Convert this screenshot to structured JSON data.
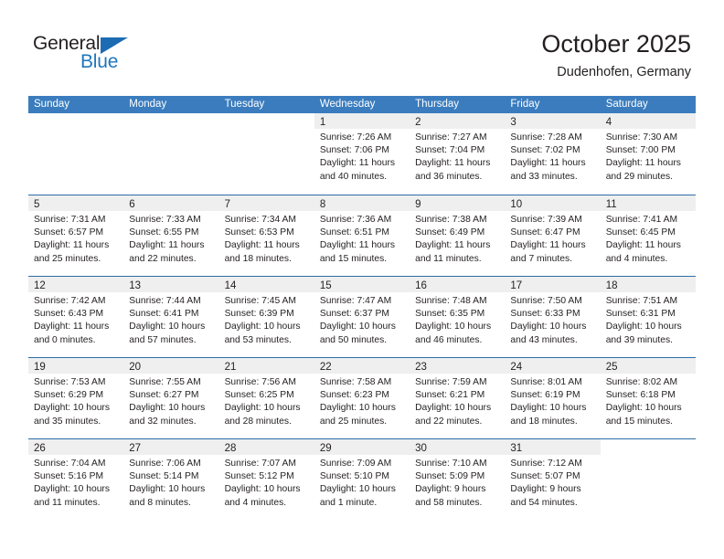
{
  "brand": {
    "name_part1": "General",
    "name_part2": "Blue",
    "accent_color": "#1d6cb3"
  },
  "header": {
    "month_title": "October 2025",
    "location": "Dudenhofen, Germany"
  },
  "calendar": {
    "header_bg": "#3a7cbe",
    "daynum_bg": "#efefef",
    "weekdays": [
      "Sunday",
      "Monday",
      "Tuesday",
      "Wednesday",
      "Thursday",
      "Friday",
      "Saturday"
    ],
    "weeks": [
      [
        {
          "day": "",
          "lines": []
        },
        {
          "day": "",
          "lines": []
        },
        {
          "day": "",
          "lines": []
        },
        {
          "day": "1",
          "lines": [
            "Sunrise: 7:26 AM",
            "Sunset: 7:06 PM",
            "Daylight: 11 hours",
            "and 40 minutes."
          ]
        },
        {
          "day": "2",
          "lines": [
            "Sunrise: 7:27 AM",
            "Sunset: 7:04 PM",
            "Daylight: 11 hours",
            "and 36 minutes."
          ]
        },
        {
          "day": "3",
          "lines": [
            "Sunrise: 7:28 AM",
            "Sunset: 7:02 PM",
            "Daylight: 11 hours",
            "and 33 minutes."
          ]
        },
        {
          "day": "4",
          "lines": [
            "Sunrise: 7:30 AM",
            "Sunset: 7:00 PM",
            "Daylight: 11 hours",
            "and 29 minutes."
          ]
        }
      ],
      [
        {
          "day": "5",
          "lines": [
            "Sunrise: 7:31 AM",
            "Sunset: 6:57 PM",
            "Daylight: 11 hours",
            "and 25 minutes."
          ]
        },
        {
          "day": "6",
          "lines": [
            "Sunrise: 7:33 AM",
            "Sunset: 6:55 PM",
            "Daylight: 11 hours",
            "and 22 minutes."
          ]
        },
        {
          "day": "7",
          "lines": [
            "Sunrise: 7:34 AM",
            "Sunset: 6:53 PM",
            "Daylight: 11 hours",
            "and 18 minutes."
          ]
        },
        {
          "day": "8",
          "lines": [
            "Sunrise: 7:36 AM",
            "Sunset: 6:51 PM",
            "Daylight: 11 hours",
            "and 15 minutes."
          ]
        },
        {
          "day": "9",
          "lines": [
            "Sunrise: 7:38 AM",
            "Sunset: 6:49 PM",
            "Daylight: 11 hours",
            "and 11 minutes."
          ]
        },
        {
          "day": "10",
          "lines": [
            "Sunrise: 7:39 AM",
            "Sunset: 6:47 PM",
            "Daylight: 11 hours",
            "and 7 minutes."
          ]
        },
        {
          "day": "11",
          "lines": [
            "Sunrise: 7:41 AM",
            "Sunset: 6:45 PM",
            "Daylight: 11 hours",
            "and 4 minutes."
          ]
        }
      ],
      [
        {
          "day": "12",
          "lines": [
            "Sunrise: 7:42 AM",
            "Sunset: 6:43 PM",
            "Daylight: 11 hours",
            "and 0 minutes."
          ]
        },
        {
          "day": "13",
          "lines": [
            "Sunrise: 7:44 AM",
            "Sunset: 6:41 PM",
            "Daylight: 10 hours",
            "and 57 minutes."
          ]
        },
        {
          "day": "14",
          "lines": [
            "Sunrise: 7:45 AM",
            "Sunset: 6:39 PM",
            "Daylight: 10 hours",
            "and 53 minutes."
          ]
        },
        {
          "day": "15",
          "lines": [
            "Sunrise: 7:47 AM",
            "Sunset: 6:37 PM",
            "Daylight: 10 hours",
            "and 50 minutes."
          ]
        },
        {
          "day": "16",
          "lines": [
            "Sunrise: 7:48 AM",
            "Sunset: 6:35 PM",
            "Daylight: 10 hours",
            "and 46 minutes."
          ]
        },
        {
          "day": "17",
          "lines": [
            "Sunrise: 7:50 AM",
            "Sunset: 6:33 PM",
            "Daylight: 10 hours",
            "and 43 minutes."
          ]
        },
        {
          "day": "18",
          "lines": [
            "Sunrise: 7:51 AM",
            "Sunset: 6:31 PM",
            "Daylight: 10 hours",
            "and 39 minutes."
          ]
        }
      ],
      [
        {
          "day": "19",
          "lines": [
            "Sunrise: 7:53 AM",
            "Sunset: 6:29 PM",
            "Daylight: 10 hours",
            "and 35 minutes."
          ]
        },
        {
          "day": "20",
          "lines": [
            "Sunrise: 7:55 AM",
            "Sunset: 6:27 PM",
            "Daylight: 10 hours",
            "and 32 minutes."
          ]
        },
        {
          "day": "21",
          "lines": [
            "Sunrise: 7:56 AM",
            "Sunset: 6:25 PM",
            "Daylight: 10 hours",
            "and 28 minutes."
          ]
        },
        {
          "day": "22",
          "lines": [
            "Sunrise: 7:58 AM",
            "Sunset: 6:23 PM",
            "Daylight: 10 hours",
            "and 25 minutes."
          ]
        },
        {
          "day": "23",
          "lines": [
            "Sunrise: 7:59 AM",
            "Sunset: 6:21 PM",
            "Daylight: 10 hours",
            "and 22 minutes."
          ]
        },
        {
          "day": "24",
          "lines": [
            "Sunrise: 8:01 AM",
            "Sunset: 6:19 PM",
            "Daylight: 10 hours",
            "and 18 minutes."
          ]
        },
        {
          "day": "25",
          "lines": [
            "Sunrise: 8:02 AM",
            "Sunset: 6:18 PM",
            "Daylight: 10 hours",
            "and 15 minutes."
          ]
        }
      ],
      [
        {
          "day": "26",
          "lines": [
            "Sunrise: 7:04 AM",
            "Sunset: 5:16 PM",
            "Daylight: 10 hours",
            "and 11 minutes."
          ]
        },
        {
          "day": "27",
          "lines": [
            "Sunrise: 7:06 AM",
            "Sunset: 5:14 PM",
            "Daylight: 10 hours",
            "and 8 minutes."
          ]
        },
        {
          "day": "28",
          "lines": [
            "Sunrise: 7:07 AM",
            "Sunset: 5:12 PM",
            "Daylight: 10 hours",
            "and 4 minutes."
          ]
        },
        {
          "day": "29",
          "lines": [
            "Sunrise: 7:09 AM",
            "Sunset: 5:10 PM",
            "Daylight: 10 hours",
            "and 1 minute."
          ]
        },
        {
          "day": "30",
          "lines": [
            "Sunrise: 7:10 AM",
            "Sunset: 5:09 PM",
            "Daylight: 9 hours",
            "and 58 minutes."
          ]
        },
        {
          "day": "31",
          "lines": [
            "Sunrise: 7:12 AM",
            "Sunset: 5:07 PM",
            "Daylight: 9 hours",
            "and 54 minutes."
          ]
        },
        {
          "day": "",
          "lines": []
        }
      ]
    ]
  }
}
